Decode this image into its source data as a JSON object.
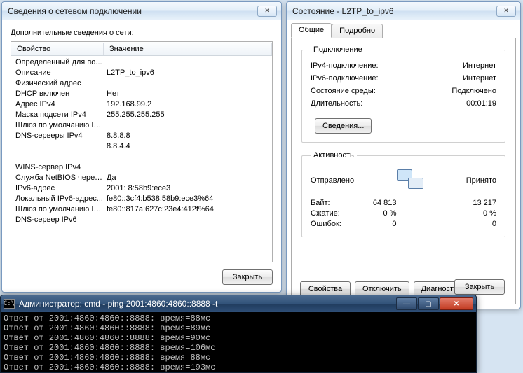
{
  "win1": {
    "title": "Сведения о сетевом подключении",
    "subtitle": "Дополнительные сведения о сети:",
    "col_property": "Свойство",
    "col_value": "Значение",
    "rows": [
      {
        "k": "Определенный для по...",
        "v": ""
      },
      {
        "k": "Описание",
        "v": "L2TP_to_ipv6"
      },
      {
        "k": "Физический адрес",
        "v": ""
      },
      {
        "k": "DHCP включен",
        "v": "Нет"
      },
      {
        "k": "Адрес IPv4",
        "v": "192.168.99.2"
      },
      {
        "k": "Маска подсети IPv4",
        "v": "255.255.255.255"
      },
      {
        "k": "Шлюз по умолчанию IP...",
        "v": ""
      },
      {
        "k": "DNS-серверы IPv4",
        "v": "8.8.8.8"
      },
      {
        "k": "",
        "v": "8.8.4.4"
      },
      {
        "k": "WINS-сервер IPv4",
        "v": ""
      },
      {
        "k": "Служба NetBIOS через...",
        "v": "Да"
      },
      {
        "k": "IPv6-адрес",
        "v": "2001:                                  8:58b9:ece3"
      },
      {
        "k": "Локальный IPv6-адрес...",
        "v": "fe80::3cf4:b538:58b9:ece3%64"
      },
      {
        "k": "Шлюз по умолчанию IP...",
        "v": "fe80::817a:627c:23e4:412f%64"
      },
      {
        "k": "DNS-сервер IPv6",
        "v": ""
      }
    ],
    "close_btn": "Закрыть"
  },
  "win2": {
    "title": "Состояние - L2TP_to_ipv6",
    "tab_general": "Общие",
    "tab_details": "Подробно",
    "group_conn": "Подключение",
    "ipv4_label": "IPv4-подключение:",
    "ipv4_val": "Интернет",
    "ipv6_label": "IPv6-подключение:",
    "ipv6_val": "Интернет",
    "media_label": "Состояние среды:",
    "media_val": "Подключено",
    "dur_label": "Длительность:",
    "dur_val": "00:01:19",
    "details_btn": "Сведения...",
    "group_activity": "Активность",
    "sent_label": "Отправлено",
    "recv_label": "Принято",
    "bytes_label": "Байт:",
    "bytes_sent": "64 813",
    "bytes_recv": "13 217",
    "comp_label": "Сжатие:",
    "comp_sent": "0 %",
    "comp_recv": "0 %",
    "err_label": "Ошибок:",
    "err_sent": "0",
    "err_recv": "0",
    "props_btn": "Свойства",
    "disc_btn": "Отключить",
    "diag_btn": "Диагностика",
    "close_btn": "Закрыть"
  },
  "cmd": {
    "title": "Администратор: cmd - ping  2001:4860:4860::8888 -t",
    "lines": [
      "Ответ от 2001:4860:4860::8888: время=88мс",
      "Ответ от 2001:4860:4860::8888: время=89мс",
      "Ответ от 2001:4860:4860::8888: время=90мс",
      "Ответ от 2001:4860:4860::8888: время=106мс",
      "Ответ от 2001:4860:4860::8888: время=88мс",
      "Ответ от 2001:4860:4860::8888: время=193мс"
    ]
  }
}
